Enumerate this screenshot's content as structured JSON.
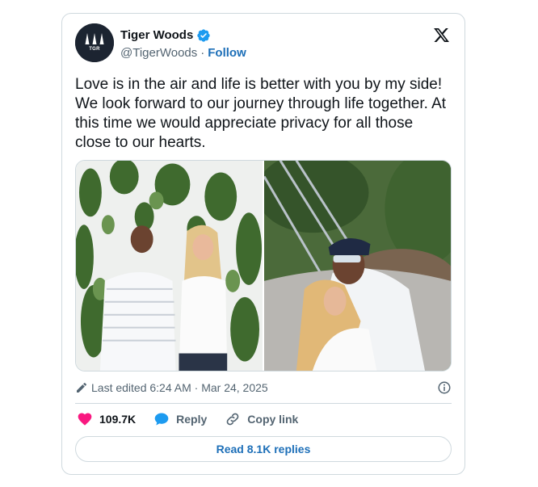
{
  "author": {
    "name": "Tiger Woods",
    "handle": "@TigerWoods",
    "separator": "·",
    "follow_label": "Follow",
    "avatar_text": "TGR"
  },
  "tweet": {
    "text": "Love is in the air and life is better with you by my side! We look forward to our journey through life together. At this time we would appreciate privacy for all those close to our hearts."
  },
  "meta": {
    "edited_label": "Last edited 6:24 AM · Mar 24, 2025"
  },
  "actions": {
    "like_count": "109.7K",
    "reply_label": "Reply",
    "copy_link_label": "Copy link"
  },
  "footer": {
    "read_replies_label": "Read 8.1K replies"
  },
  "colors": {
    "like": "#f91880",
    "reply": "#1d9bf0",
    "link": "#1d6fb8",
    "verified": "#1d9bf0",
    "border": "#cfd9de"
  },
  "icons": [
    "verified-badge-icon",
    "x-logo-icon",
    "pencil-icon",
    "info-icon",
    "heart-icon",
    "reply-bubble-icon",
    "link-icon"
  ]
}
